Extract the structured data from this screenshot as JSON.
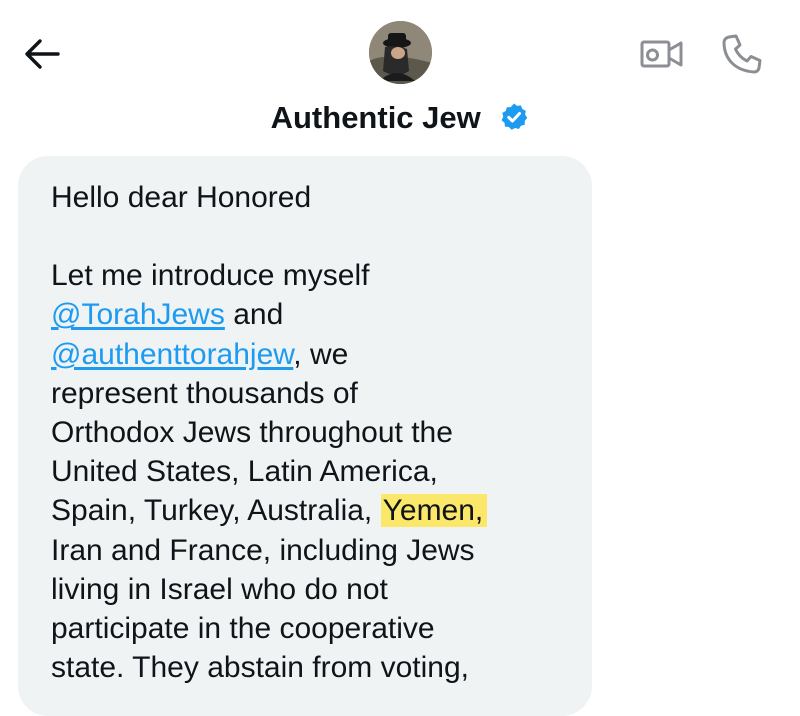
{
  "header": {
    "display_name": "Authentic Jew",
    "verified_badge_color": "#1d9bf0",
    "icons": {
      "back": "arrow-left-icon",
      "video": "video-camera-icon",
      "call": "phone-icon"
    }
  },
  "message": {
    "greeting": "Hello dear Honored",
    "line_intro": "Let me introduce myself",
    "mention1": "@TorahJews",
    "text_and": " and",
    "mention2": "@authenttorahjew",
    "text_we": ", we",
    "line_represent": "represent thousands of",
    "line_orthodox": "Orthodox Jews throughout the",
    "line_us": "United States, Latin America,",
    "line_spain": "Spain, Turkey, Australia,",
    "highlighted": "Yemen,",
    "line_iran": "Iran and France, including Jews",
    "line_living": "living in Israel who do not",
    "line_participate": "participate in the cooperative",
    "line_state": "state.  They abstain from voting,"
  },
  "colors": {
    "bubble_bg": "#eff3f4",
    "mention": "#1d9bf0",
    "highlight": "#fbe86a",
    "text": "#0f1419"
  }
}
